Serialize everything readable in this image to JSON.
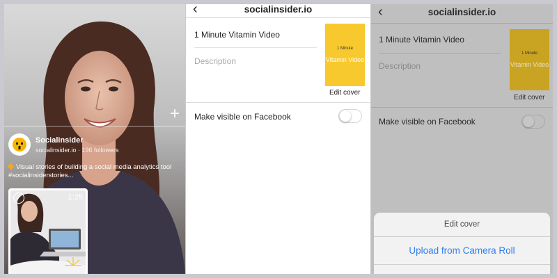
{
  "story_panel": {
    "account_name": "Socialinsider",
    "account_meta": "socialinsider.io · 196 followers",
    "description": "Visual stories of building a social media analytics tool #socialinsiderstories...",
    "thumbnail_duration": "1:25",
    "add_icon": "plus-icon",
    "check_icon": "check-circle-icon",
    "bullet_color": "#f5a623"
  },
  "edit_panel": {
    "header_title": "socialinsider.io",
    "back_icon": "chevron-left-icon",
    "video_title": "1 Minute Vitamin Video",
    "description_placeholder": "Description",
    "cover_small_text": "1 Minute",
    "cover_large_text": "Vitamin Video",
    "edit_cover_label": "Edit cover",
    "facebook_label": "Make visible on Facebook",
    "facebook_visible": false,
    "cover_color": "#f8c92e"
  },
  "action_sheet": {
    "title": "Edit cover",
    "upload_label": "Upload from Camera Roll",
    "action_color": "#2f7ff0"
  }
}
